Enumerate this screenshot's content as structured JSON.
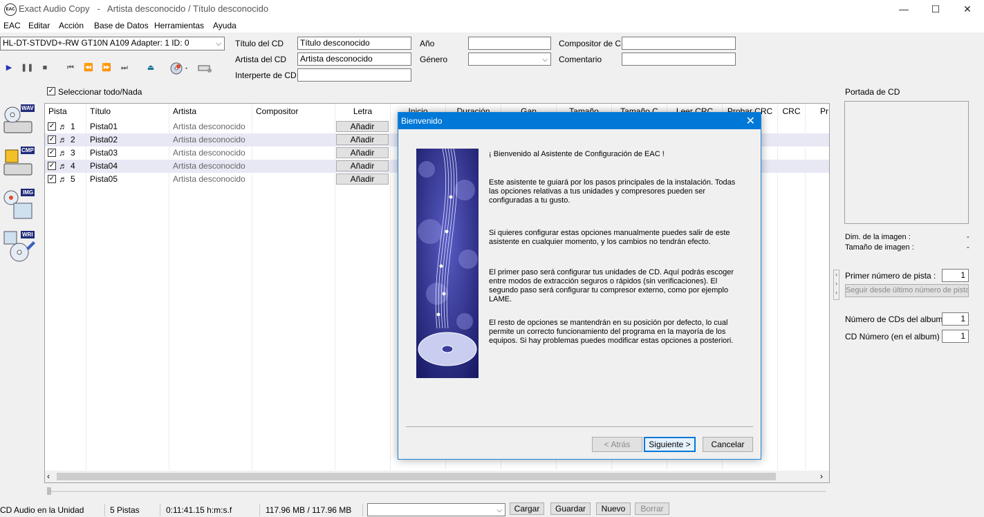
{
  "window": {
    "app_icon_text": "EAC",
    "title": "Exact Audio Copy   -   Artista desconocido / Título desconocido",
    "minimize": "—",
    "maximize": "☐",
    "close": "✕"
  },
  "menu": [
    "EAC",
    "Editar",
    "Acción",
    "Base de Datos",
    "Herramientas",
    "Ayuda"
  ],
  "drive": {
    "selected": "HL-DT-STDVD+-RW GT10N A109   Adapter: 1  ID: 0"
  },
  "cd_info": {
    "title_label": "Título del CD",
    "title_value": "Título desconocido",
    "artist_label": "Artista del CD",
    "artist_value": "Artista desconocido",
    "performer_label": "Interperte de CD",
    "performer_value": "",
    "year_label": "Año",
    "year_value": "",
    "genre_label": "Género",
    "genre_value": "",
    "composer_label": "Compositor de CD",
    "composer_value": "",
    "comment_label": "Comentario",
    "comment_value": ""
  },
  "toolbar_icons": [
    "play-icon",
    "pause-icon",
    "stop-icon",
    "first-track-icon",
    "rewind-icon",
    "fast-forward-icon",
    "last-track-icon",
    "eject-icon",
    "cd-database-icon",
    "drive-options-icon"
  ],
  "select_all_label": "Seleccionar todo/Nada",
  "columns": [
    "Pista",
    "Título",
    "Artista",
    "Compositor",
    "Letra",
    "Inicio",
    "Duración",
    "Gap",
    "Tamaño",
    "Tamaño C",
    "Leer CRC",
    "Probar CRC",
    "CRC",
    "Pr"
  ],
  "tracks": [
    {
      "num": "1",
      "title": "Pista01",
      "artist": "Artista desconocido",
      "lyrics": "Añadir"
    },
    {
      "num": "2",
      "title": "Pista02",
      "artist": "Artista desconocido",
      "lyrics": "Añadir"
    },
    {
      "num": "3",
      "title": "Pista03",
      "artist": "Artista desconocido",
      "lyrics": "Añadir"
    },
    {
      "num": "4",
      "title": "Pista04",
      "artist": "Artista desconocido",
      "lyrics": "Añadir"
    },
    {
      "num": "5",
      "title": "Pista05",
      "artist": "Artista desconocido",
      "lyrics": "Añadir"
    }
  ],
  "side_buttons": [
    "WAV",
    "CMP",
    "IMG",
    "WRI"
  ],
  "right_panel": {
    "cover_label": "Portada de CD",
    "image_dim_label": "Dim. de la imagen :",
    "image_dim_value": "-",
    "image_size_label": "Tamaño de imagen :",
    "image_size_value": "-",
    "first_track_label": "Primer número de pista :",
    "first_track_value": "1",
    "continue_button": "Seguir desde último número de pista",
    "num_cds_label": "Número de CDs del album",
    "num_cds_value": "1",
    "cd_number_label": "CD Número (en el album)",
    "cd_number_value": "1"
  },
  "dialog": {
    "title": "Bienvenido",
    "close": "✕",
    "paragraphs": [
      "¡ Bienvenido al Asistente de Configuración de EAC !",
      "Este asistente te guiará por los pasos principales de la instalación. Todas las opciones relativas a tus unidades y compresores pueden ser configuradas a tu gusto.",
      "Si quieres configurar estas opciones manualmente puedes salir de este asistente en cualquier momento, y los cambios no tendrán efecto.",
      "El primer paso será configurar tus unidades de CD. Aquí podrás escoger entre modos de extracción seguros o rápidos (sin verificaciones). El segundo paso será configurar tu compresor externo, como por ejemplo LAME.",
      "El resto de opciones se mantendrán en su posición por defecto, lo cual permite un correcto funcionamiento del programa en la mayoría de los equipos. Si hay problemas puedes modificar estas opciones a posteriori."
    ],
    "back_button": "< Atrás",
    "next_button": "Siguiente >",
    "cancel_button": "Cancelar"
  },
  "status": {
    "disc": "CD Audio en la Unidad",
    "tracks": "5 Pistas",
    "time": "0:11:41.15 h:m:s.f",
    "size": "117.96 MB / 117.96 MB",
    "profile_value": "",
    "load": "Cargar",
    "save": "Guardar",
    "new": "Nuevo",
    "delete": "Borrar"
  },
  "colors": {
    "accent": "#0078d7",
    "alt_row": "#e8e8f5",
    "banner": "#1c1f7a"
  }
}
